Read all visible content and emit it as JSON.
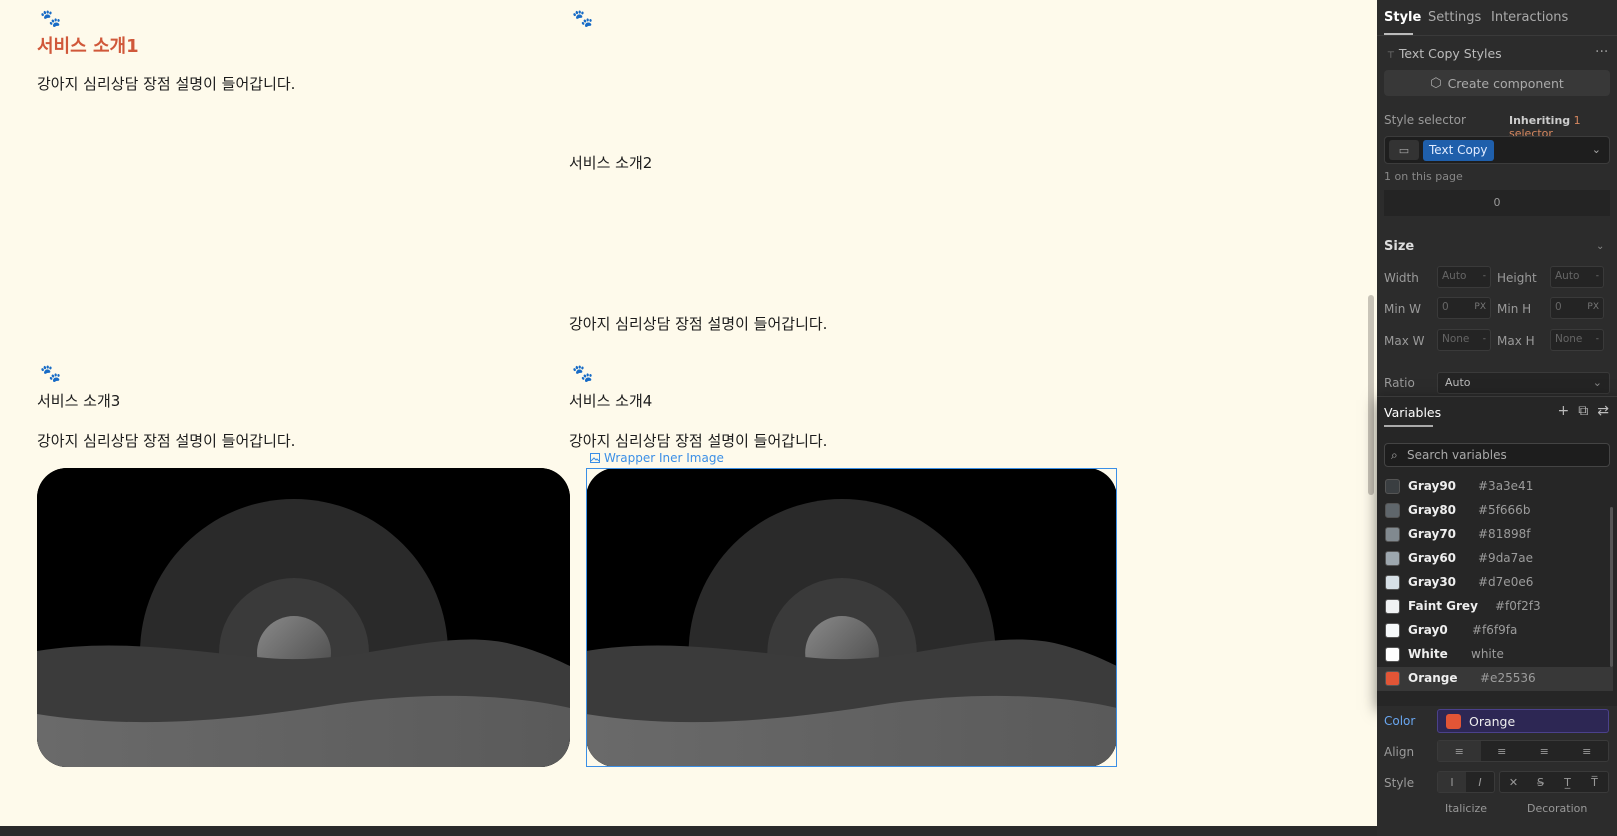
{
  "canvas": {
    "card1": {
      "icon": "paw-icon",
      "title": "서비스 소개1",
      "desc": "강아지 심리상담 장점 설명이 들어갑니다."
    },
    "card2": {
      "icon": "paw-icon",
      "title": "서비스 소개2",
      "desc": "강아지 심리상담 장점 설명이 들어갑니다."
    },
    "card3": {
      "icon": "paw-icon",
      "title": "서비스 소개3",
      "desc": "강아지 심리상담 장점 설명이 들어갑니다."
    },
    "card4": {
      "icon": "paw-icon",
      "title": "서비스 소개4",
      "desc": "강아지 심리상담 장점 설명이 들어갑니다."
    },
    "selection_label": "Wrapper Iner Image",
    "title_color": "#d0583a"
  },
  "panel": {
    "tabs": [
      "Style",
      "Settings",
      "Interactions"
    ],
    "active_tab": "Style",
    "text_copy_styles": "Text Copy Styles",
    "more": "···",
    "create_component": "Create component",
    "style_selector_label": "Style selector",
    "inheriting": "Inheriting",
    "inheriting_count": "1 selector",
    "selector_chip": "Text Copy",
    "on_this_page": "1 on this page",
    "zero_value": "0",
    "size": {
      "heading": "Size",
      "width_label": "Width",
      "width_value": "Auto",
      "width_unit": "-",
      "height_label": "Height",
      "height_value": "Auto",
      "height_unit": "-",
      "minw_label": "Min W",
      "minw_value": "0",
      "minw_unit": "PX",
      "minh_label": "Min H",
      "minh_value": "0",
      "minh_unit": "PX",
      "maxw_label": "Max W",
      "maxw_value": "None",
      "maxw_unit": "-",
      "maxh_label": "Max H",
      "maxh_value": "None",
      "maxh_unit": "-",
      "ratio_label": "Ratio",
      "ratio_value": "Auto"
    },
    "variables": {
      "title": "Variables",
      "search_placeholder": "Search variables",
      "items": [
        {
          "name": "Gray90",
          "value": "#3a3e41",
          "color": "#3a3e41"
        },
        {
          "name": "Gray80",
          "value": "#5f666b",
          "color": "#5f666b"
        },
        {
          "name": "Gray70",
          "value": "#81898f",
          "color": "#81898f"
        },
        {
          "name": "Gray60",
          "value": "#9da7ae",
          "color": "#9da7ae"
        },
        {
          "name": "Gray30",
          "value": "#d7e0e6",
          "color": "#d7e0e6"
        },
        {
          "name": "Faint Grey",
          "value": "#f0f2f3",
          "color": "#f0f2f3"
        },
        {
          "name": "Gray0",
          "value": "#f6f9fa",
          "color": "#f6f9fa"
        },
        {
          "name": "White",
          "value": "white",
          "color": "#ffffff"
        },
        {
          "name": "Orange",
          "value": "#e25536",
          "color": "#e25536"
        }
      ]
    },
    "typography": {
      "color_label": "Color",
      "color_value": "Orange",
      "align_label": "Align",
      "style_label": "Style",
      "italicize": "Italicize",
      "decoration": "Decoration"
    }
  }
}
